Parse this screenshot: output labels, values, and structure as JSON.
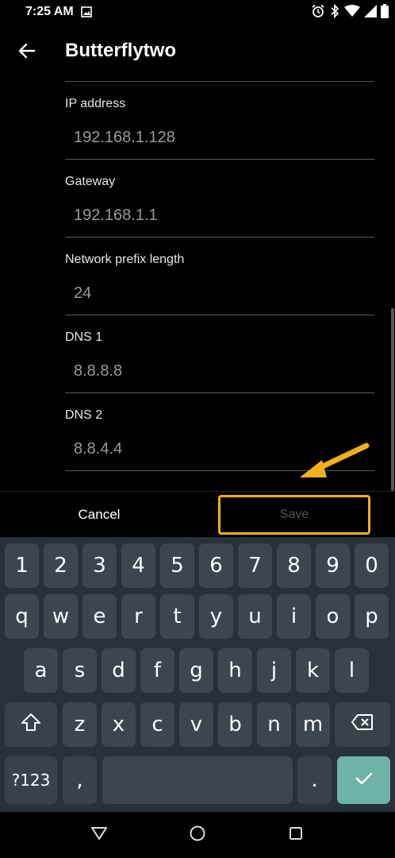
{
  "status_bar": {
    "time": "7:25 AM",
    "icons": [
      "image-icon",
      "alarm-icon",
      "bluetooth-icon",
      "wifi-icon",
      "signal-icon",
      "battery-icon"
    ]
  },
  "app_bar": {
    "title": "Butterflytwo",
    "back_icon": "back-arrow-icon"
  },
  "fields": [
    {
      "label": "IP address",
      "value": "192.168.1.128"
    },
    {
      "label": "Gateway",
      "value": "192.168.1.1"
    },
    {
      "label": "Network prefix length",
      "value": "24"
    },
    {
      "label": "DNS 1",
      "value": "8.8.8.8"
    },
    {
      "label": "DNS 2",
      "value": "8.8.4.4"
    }
  ],
  "actions": {
    "cancel": "Cancel",
    "save": "Save"
  },
  "annotation": {
    "color": "#f2b01e",
    "highlight_target": "save-button"
  },
  "keyboard": {
    "row1": [
      "1",
      "2",
      "3",
      "4",
      "5",
      "6",
      "7",
      "8",
      "9",
      "0"
    ],
    "row2": [
      "q",
      "w",
      "e",
      "r",
      "t",
      "y",
      "u",
      "i",
      "o",
      "p"
    ],
    "row3": [
      "a",
      "s",
      "d",
      "f",
      "g",
      "h",
      "j",
      "k",
      "l"
    ],
    "row4": [
      "z",
      "x",
      "c",
      "v",
      "b",
      "n",
      "m"
    ],
    "symbols_key": "?123",
    "comma_key": ",",
    "period_key": ".",
    "shift_icon": "shift-icon",
    "backspace_icon": "backspace-icon",
    "enter_icon": "checkmark-icon",
    "colors": {
      "background": "#263238",
      "key": "#3b464d",
      "enter": "#6fb3a5"
    }
  },
  "nav_bar": {
    "icons": [
      "back-triangle-icon",
      "home-circle-icon",
      "recents-square-icon"
    ]
  }
}
